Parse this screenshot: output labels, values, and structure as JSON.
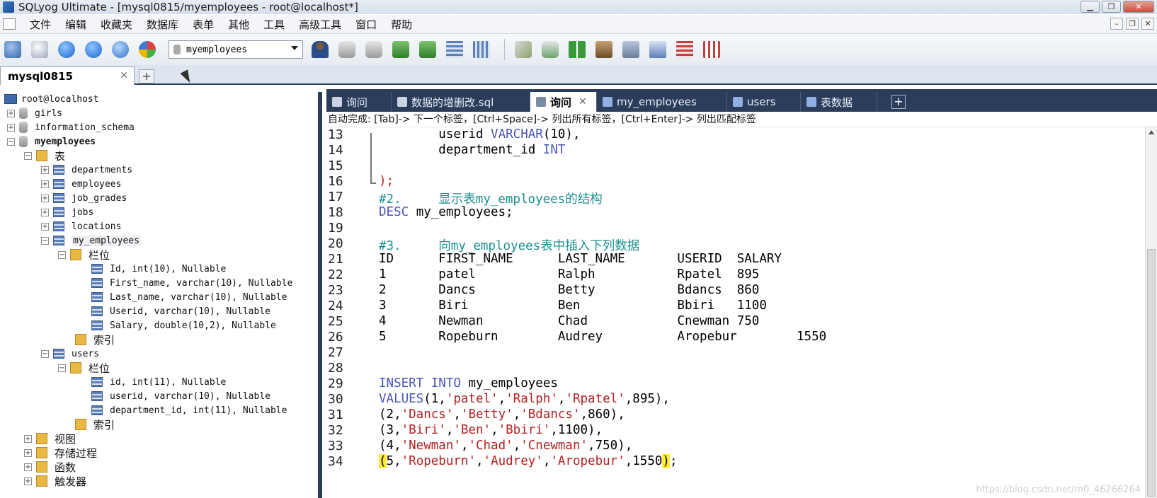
{
  "window": {
    "title": "SQLyog Ultimate - [mysql0815/myemployees - root@localhost*]",
    "min": "▁",
    "max": "❐",
    "close": "✕"
  },
  "menu": [
    "文件",
    "编辑",
    "收藏夹",
    "数据库",
    "表单",
    "其他",
    "工具",
    "高级工具",
    "窗口",
    "帮助"
  ],
  "mdi": {
    "min": "–",
    "restore": "❐",
    "close": "✕"
  },
  "toolbar": {
    "database_select": "myemployees"
  },
  "connection_tab": {
    "label": "mysql0815",
    "close": "✕",
    "add": "+"
  },
  "tree": {
    "root": "root@localhost",
    "nodes": [
      {
        "label": "girls",
        "kind": "db",
        "exp": "+"
      },
      {
        "label": "information_schema",
        "kind": "db",
        "exp": "+"
      },
      {
        "label": "myemployees",
        "kind": "db",
        "exp": "−"
      },
      {
        "label": "表",
        "kind": "folder",
        "exp": "−"
      },
      {
        "label": "departments",
        "kind": "table",
        "exp": "+"
      },
      {
        "label": "employees",
        "kind": "table",
        "exp": "+"
      },
      {
        "label": "job_grades",
        "kind": "table",
        "exp": "+"
      },
      {
        "label": "jobs",
        "kind": "table",
        "exp": "+"
      },
      {
        "label": "locations",
        "kind": "table",
        "exp": "+"
      },
      {
        "label": "my_employees",
        "kind": "table",
        "exp": "−"
      },
      {
        "label": "栏位",
        "kind": "folder",
        "exp": "−"
      },
      {
        "label": "Id, int(10), Nullable",
        "kind": "column"
      },
      {
        "label": "First_name, varchar(10), Nullable",
        "kind": "column"
      },
      {
        "label": "Last_name, varchar(10), Nullable",
        "kind": "column"
      },
      {
        "label": "Userid, varchar(10), Nullable",
        "kind": "column"
      },
      {
        "label": "Salary, double(10,2), Nullable",
        "kind": "column"
      },
      {
        "label": "索引",
        "kind": "folder"
      },
      {
        "label": "users",
        "kind": "table",
        "exp": "−"
      },
      {
        "label": "栏位",
        "kind": "folder",
        "exp": "−"
      },
      {
        "label": "id, int(11), Nullable",
        "kind": "column"
      },
      {
        "label": "userid, varchar(10), Nullable",
        "kind": "column"
      },
      {
        "label": "department_id, int(11), Nullable",
        "kind": "column"
      },
      {
        "label": "索引",
        "kind": "folder"
      },
      {
        "label": "视图",
        "kind": "folder",
        "exp": "+"
      },
      {
        "label": "存储过程",
        "kind": "folder",
        "exp": "+"
      },
      {
        "label": "函数",
        "kind": "folder",
        "exp": "+"
      },
      {
        "label": "触发器",
        "kind": "folder",
        "exp": "+"
      }
    ]
  },
  "editor_tabs": [
    {
      "label": "询问",
      "color": "#c9d3e3"
    },
    {
      "label": "数据的增删改.sql",
      "color": "#c9d3e3"
    },
    {
      "label": "询问",
      "active": true,
      "close": "✕",
      "color": "#7a8aa3"
    },
    {
      "label": "my_employees",
      "color": "#8fb0e0"
    },
    {
      "label": "users",
      "color": "#8fb0e0"
    },
    {
      "label": "表数据",
      "color": "#8fb0e0"
    }
  ],
  "editor_tab_add": "+",
  "hint": "自动完成: [Tab]-> 下一个标签，[Ctrl+Space]-> 列出所有标签，[Ctrl+Enter]-> 列出匹配标签",
  "editor": {
    "line_numbers": [
      "13",
      "14",
      "15",
      "16",
      "17",
      "18",
      "19",
      "20",
      "21",
      "22",
      "23",
      "24",
      "25",
      "26",
      "27",
      "28",
      "29",
      "30",
      "31",
      "32",
      "33",
      "34"
    ],
    "lines": {
      "l13": {
        "a": "        userid ",
        "kw": "VARCHAR",
        "b": "(10),"
      },
      "l14": {
        "a": "        department_id ",
        "kw": "INT"
      },
      "l16": {
        "a": ");"
      },
      "l17": {
        "c": "#2.     显示表my_employees的结构"
      },
      "l18": {
        "kw": "DESC",
        "b": " my_employees;"
      },
      "l20": {
        "c": "#3.     向my_employees表中插入下列数据"
      },
      "l21": "ID      FIRST_NAME      LAST_NAME       USERID  SALARY",
      "l22": "1       patel           Ralph           Rpatel  895",
      "l23": "2       Dancs           Betty           Bdancs  860",
      "l24": "3       Biri            Ben             Bbiri   1100",
      "l25": "4       Newman          Chad            Cnewman 750",
      "l26": "5       Ropeburn        Audrey          Aropebur        1550",
      "l29": {
        "kw1": "INSERT",
        "kw2": "INTO",
        "b": " my_employees"
      },
      "l30": {
        "kw": "VALUES",
        "p1": "(1,",
        "s1": "'patel'",
        "s2": "'Ralph'",
        "s3": "'Rpatel'",
        "p2": ",895),"
      },
      "l31": {
        "p1": "(2,",
        "s1": "'Dancs'",
        "s2": "'Betty'",
        "s3": "'Bdancs'",
        "p2": ",860),"
      },
      "l32": {
        "p1": "(3,",
        "s1": "'Biri'",
        "s2": "'Ben'",
        "s3": "'Bbiri'",
        "p2": ",1100),"
      },
      "l33": {
        "p1": "(4,",
        "s1": "'Newman'",
        "s2": "'Chad'",
        "s3": "'Cnewman'",
        "p2": ",750),"
      },
      "l34": {
        "open": "(",
        "p1": "5,",
        "s1": "'Ropeburn'",
        "s2": "'Audrey'",
        "s3": "'Aropebur'",
        "p2": ",1550",
        "close": ")",
        "end": ";"
      }
    }
  },
  "watermark": "https://blog.csdn.net/m0_46266264",
  "colors": {
    "keyword": "#4a55b8",
    "string": "#b22222",
    "comment": "#1c8f8f",
    "panel_dark": "#2b3d5a",
    "brace_highlight": "#ffee33"
  }
}
